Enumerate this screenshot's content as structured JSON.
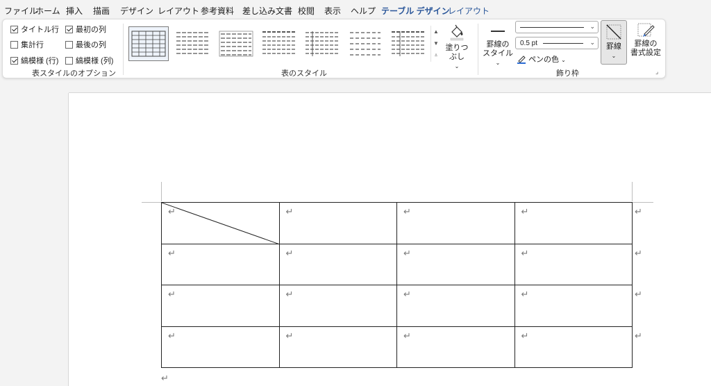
{
  "menu": {
    "tabs": [
      "ファイル",
      "ホーム",
      "挿入",
      "描画",
      "デザイン",
      "レイアウト",
      "参考資料",
      "差し込み文書",
      "校閲",
      "表示",
      "ヘルプ",
      "テーブル デザイン",
      "レイアウト"
    ]
  },
  "ribbon": {
    "style_options": {
      "title_row": "タイトル行",
      "first_col": "最初の列",
      "total_row": "集計行",
      "last_col": "最後の列",
      "banded_rows": "縞模様 (行)",
      "banded_cols": "縞模様 (列)",
      "group_label": "表スタイルのオプション"
    },
    "table_styles": {
      "group_label": "表のスタイル"
    },
    "shading": {
      "label": "塗りつぶし"
    },
    "borders": {
      "border_style_line1": "罫線の",
      "border_style_line2": "スタイル",
      "pen_weight": "0.5 pt",
      "pen_color": "ペンの色",
      "border_btn": "罫線",
      "painter_line1": "罫線の",
      "painter_line2": "書式設定",
      "group_label": "飾り枠"
    }
  },
  "document": {
    "paragraph_mark": "↵",
    "row_end_mark": "↵"
  },
  "colors": {
    "accent": "#2b579a",
    "ribbon_bg": "#ffffff",
    "app_bg": "#f3f3f3"
  }
}
